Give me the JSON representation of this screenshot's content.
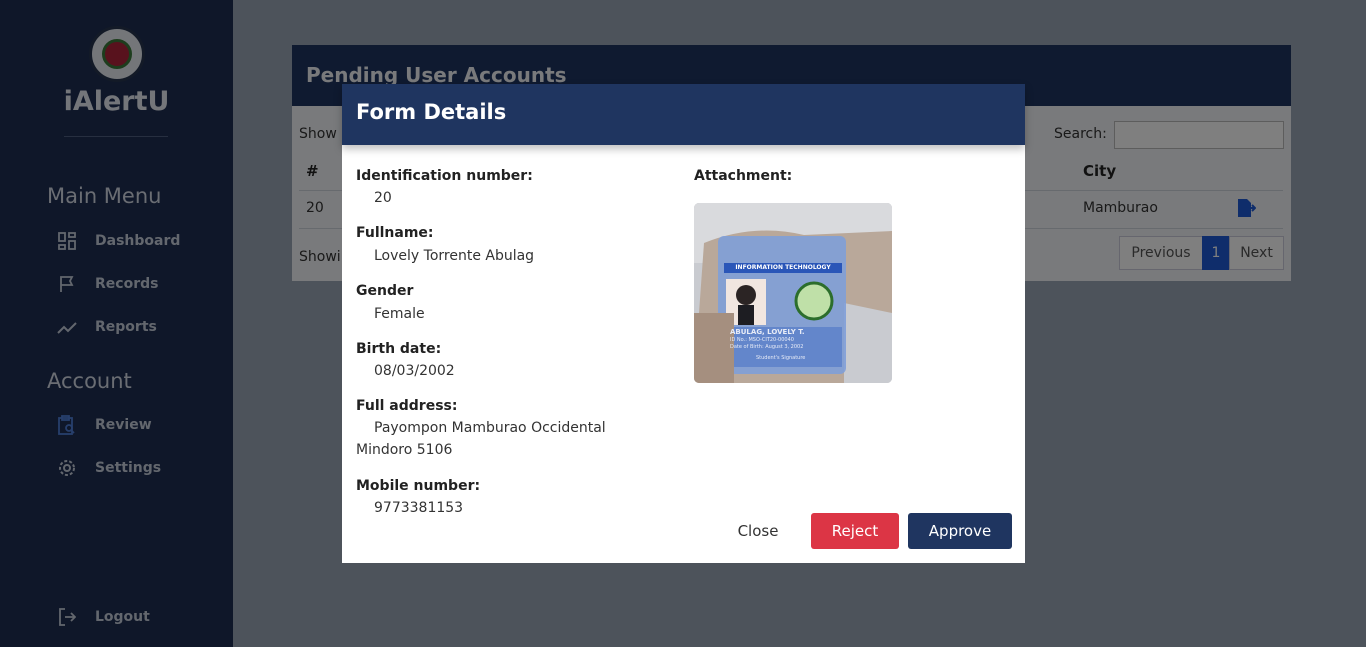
{
  "sidebar": {
    "brand": "iAlertU",
    "main_menu_title": "Main Menu",
    "account_title": "Account",
    "items": [
      {
        "label": "Dashboard"
      },
      {
        "label": "Records"
      },
      {
        "label": "Reports"
      },
      {
        "label": "Review"
      },
      {
        "label": "Settings"
      },
      {
        "label": "Logout"
      }
    ]
  },
  "page": {
    "title": "Pending User Accounts",
    "show_label": "Show",
    "search_label": "Search:",
    "columns": {
      "num": "#",
      "city": "City"
    },
    "row": {
      "num": "20",
      "city": "Mamburao"
    },
    "showing": "Showi",
    "pagination": {
      "previous": "Previous",
      "page": "1",
      "next": "Next"
    }
  },
  "modal": {
    "title": "Form Details",
    "fields": [
      {
        "label": "Identification number:",
        "value": "20"
      },
      {
        "label": "Fullname:",
        "value": "Lovely Torrente Abulag"
      },
      {
        "label": "Gender",
        "value": "Female"
      },
      {
        "label": "Birth date:",
        "value": "08/03/2002"
      },
      {
        "label": "Full address:",
        "value": "Payompon Mamburao Occidental Mindoro 5106"
      },
      {
        "label": "Mobile number:",
        "value": "9773381153"
      }
    ],
    "attachment_label": "Attachment:",
    "attachment_card": {
      "header": "INFORMATION TECHNOLOGY",
      "name": "ABULAG, LOVELY T.",
      "id_line": "ID No.: MSO-CIT20-00040",
      "dob_line": "Date of Birth: August 3, 2002",
      "signature": "Student's Signature"
    },
    "buttons": {
      "close": "Close",
      "reject": "Reject",
      "approve": "Approve"
    }
  },
  "colors": {
    "primary": "#1f3560",
    "danger": "#dc3545",
    "link": "#1f5bd6"
  }
}
